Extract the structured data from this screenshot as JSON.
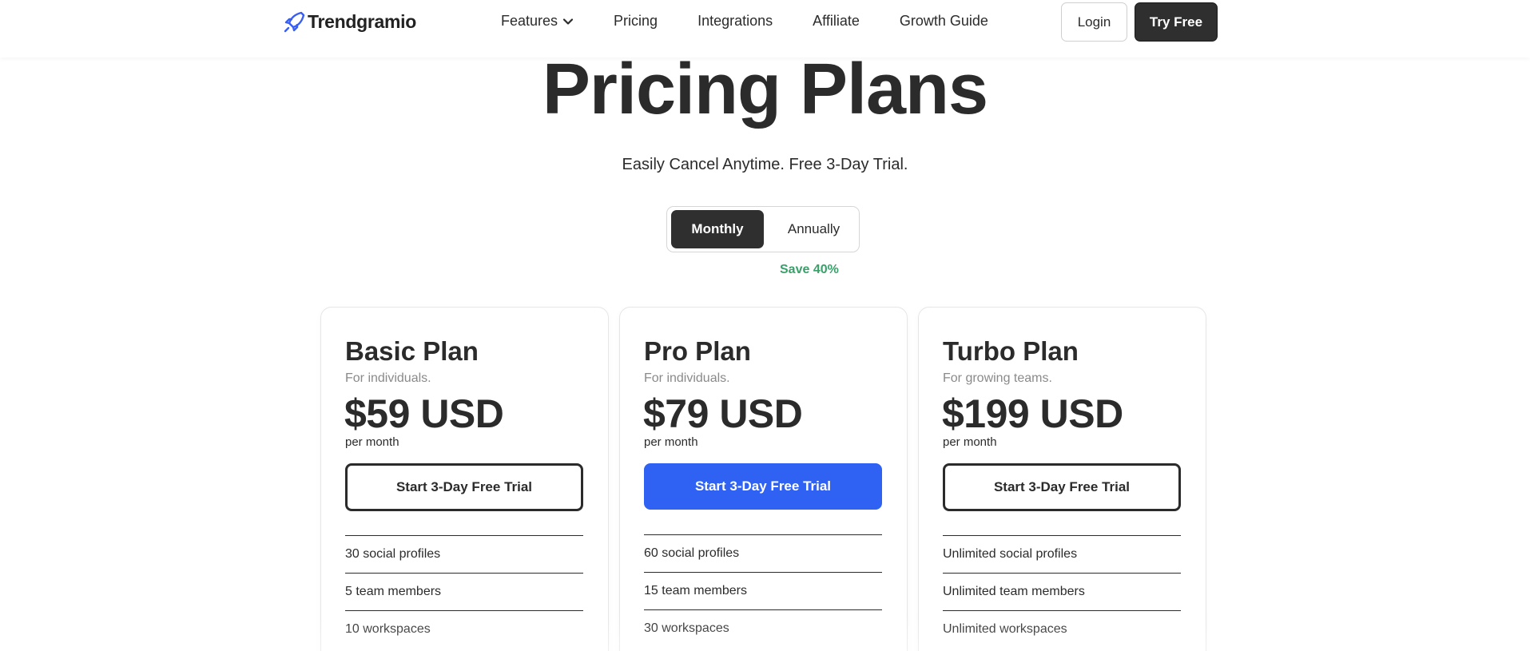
{
  "header": {
    "logo_text": "Trendgramio",
    "logo_icon": "rocket-icon",
    "nav": [
      {
        "label": "Features",
        "has_dropdown": true
      },
      {
        "label": "Pricing"
      },
      {
        "label": "Integrations"
      },
      {
        "label": "Affiliate"
      },
      {
        "label": "Growth Guide"
      }
    ],
    "login_label": "Login",
    "try_label": "Try Free"
  },
  "hero": {
    "title": "Pricing Plans",
    "subtitle": "Easily Cancel Anytime. Free 3-Day Trial."
  },
  "billing_toggle": {
    "options": [
      "Monthly",
      "Annually"
    ],
    "selected": "Monthly",
    "save_badge": "Save 40%"
  },
  "plans": [
    {
      "name": "Basic Plan",
      "description": "For individuals.",
      "price": "$59 USD",
      "period": "per month",
      "cta": "Start 3-Day Free Trial",
      "highlighted": false,
      "features": [
        "30 social profiles",
        "5 team members",
        "10 workspaces"
      ]
    },
    {
      "name": "Pro Plan",
      "description": "For individuals.",
      "price": "$79 USD",
      "period": "per month",
      "cta": "Start 3-Day Free Trial",
      "highlighted": true,
      "features": [
        "60 social profiles",
        "15 team members",
        "30 workspaces"
      ]
    },
    {
      "name": "Turbo Plan",
      "description": "For growing teams.",
      "price": "$199 USD",
      "period": "per month",
      "cta": "Start 3-Day Free Trial",
      "highlighted": false,
      "features": [
        "Unlimited social profiles",
        "Unlimited team members",
        "Unlimited workspaces"
      ]
    }
  ],
  "colors": {
    "primary": "#2f62f2",
    "dark": "#2f2f2f",
    "save_green": "#3aa06a",
    "text": "#2b2b2b",
    "muted": "#8a8a8a"
  }
}
